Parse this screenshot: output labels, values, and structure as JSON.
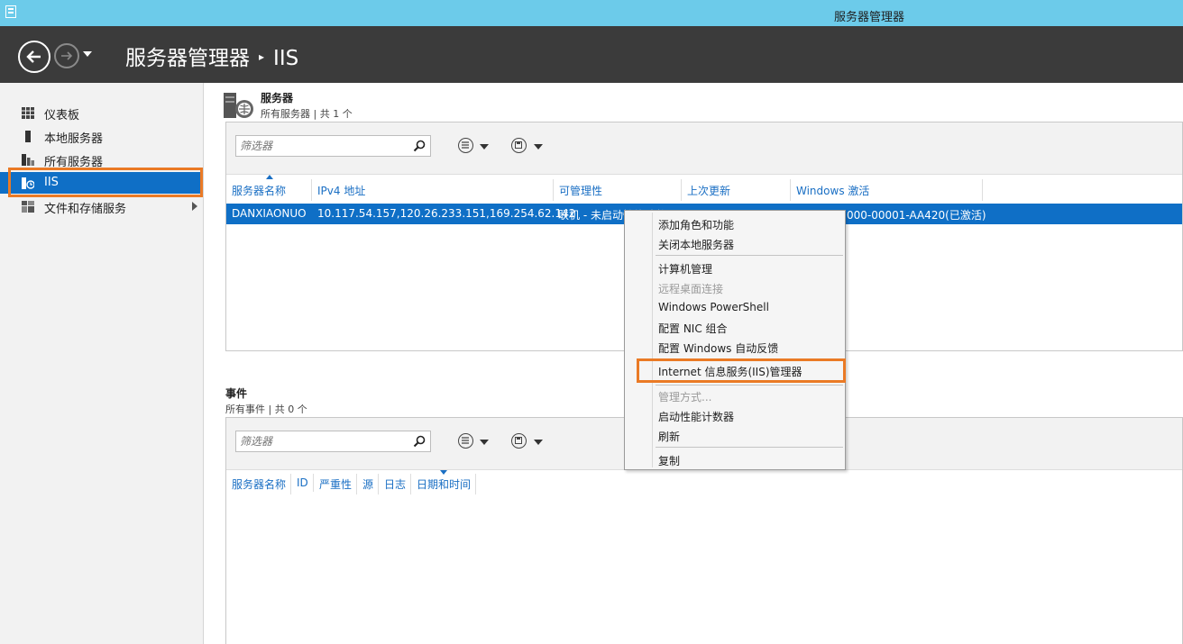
{
  "window": {
    "title": "服务器管理器"
  },
  "header": {
    "app": "服务器管理器",
    "separator": "▸",
    "current": "IIS"
  },
  "sidebar": {
    "items": [
      {
        "label": "仪表板",
        "icon": "dashboard-icon"
      },
      {
        "label": "本地服务器",
        "icon": "local-server-icon"
      },
      {
        "label": "所有服务器",
        "icon": "all-servers-icon"
      },
      {
        "label": "IIS",
        "icon": "iis-icon",
        "active": true
      },
      {
        "label": "文件和存储服务",
        "icon": "file-storage-icon",
        "expandable": true
      }
    ]
  },
  "servers": {
    "title": "服务器",
    "subtitle": "所有服务器 | 共 1 个",
    "filter_placeholder": "筛选器",
    "columns": [
      "服务器名称",
      "IPv4 地址",
      "可管理性",
      "上次更新",
      "Windows 激活"
    ],
    "row": {
      "name": "DANXIAONUO",
      "ipv4": "10.117.54.157,120.26.233.151,169.254.62.142",
      "manageability": "联机 - 未启动性能计数器",
      "last_update": "",
      "activation": "000-00001-AA420(已激活)"
    }
  },
  "events": {
    "title": "事件",
    "subtitle": "所有事件 | 共 0 个",
    "filter_placeholder": "筛选器",
    "columns": [
      "服务器名称",
      "ID",
      "严重性",
      "源",
      "日志",
      "日期和时间"
    ]
  },
  "context_menu": {
    "items": [
      "添加角色和功能",
      "关闭本地服务器",
      "计算机管理",
      "远程桌面连接",
      "Windows PowerShell",
      "配置 NIC 组合",
      "配置 Windows 自动反馈",
      "Internet 信息服务(IIS)管理器",
      "管理方式...",
      "启动性能计数器",
      "刷新",
      "复制"
    ]
  },
  "colors": {
    "accent": "#0f6fc6",
    "highlight": "#ea7a25",
    "titlebar": "#6ccbea",
    "header": "#3b3b3b"
  }
}
